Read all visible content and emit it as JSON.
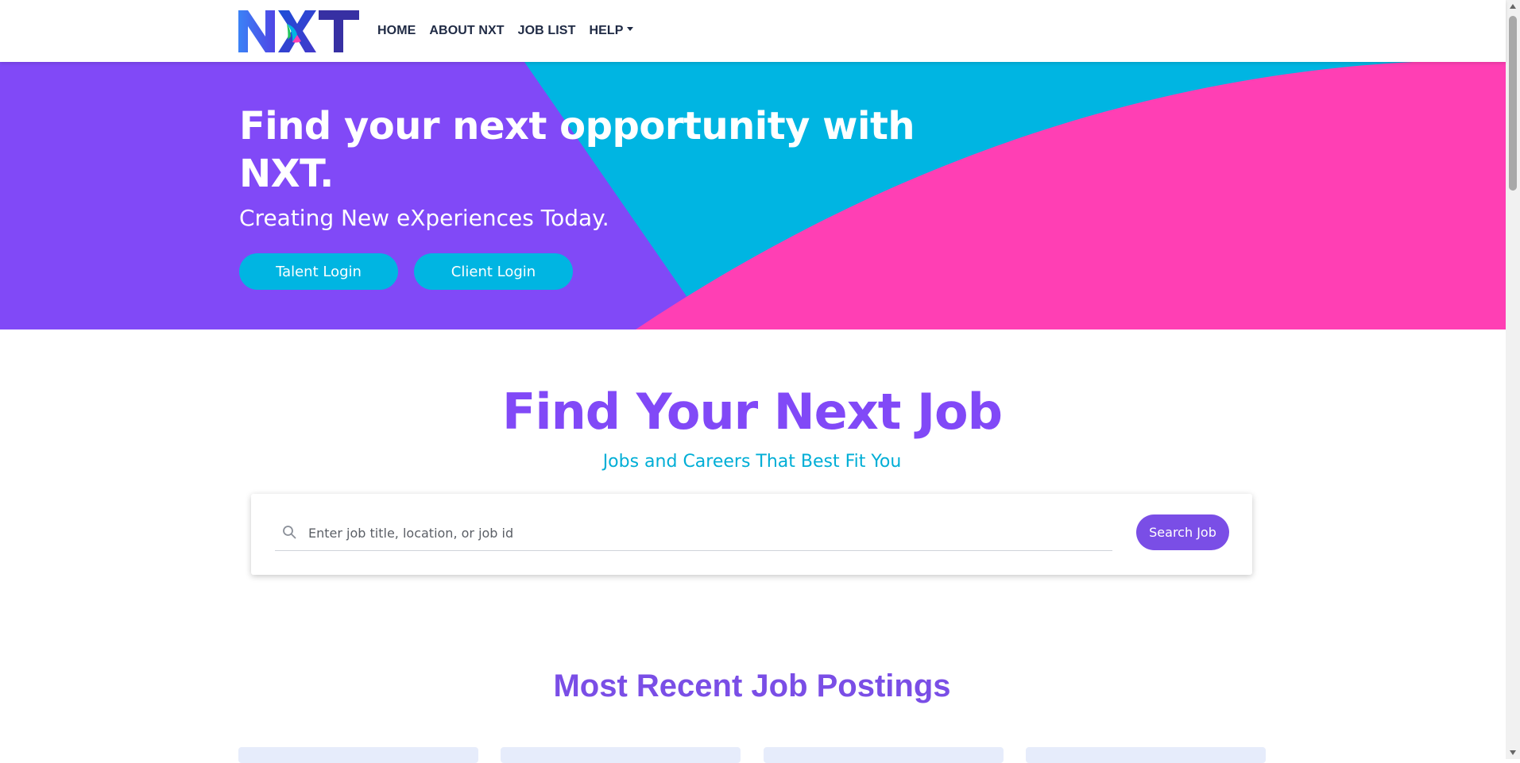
{
  "header": {
    "logo_text": "NXT",
    "nav": {
      "home": "HOME",
      "about": "ABOUT NXT",
      "job_list": "JOB LIST",
      "help": "HELP"
    }
  },
  "hero": {
    "title": "Find your next opportunity with NXT.",
    "subtitle": "Creating New eXperiences Today.",
    "talent_login": "Talent Login",
    "client_login": "Client Login"
  },
  "find": {
    "title": "Find Your Next Job",
    "subtitle": "Jobs and Careers That Best Fit You",
    "search_placeholder": "Enter job title, location, or job id",
    "search_button": "Search Job"
  },
  "recent": {
    "title": "Most Recent Job Postings"
  },
  "colors": {
    "purple": "#8149f7",
    "cyan": "#00b5e2",
    "pink": "#ff3fb4",
    "button_purple": "#7a4ee6",
    "nav_text": "#1f2a44"
  },
  "icons": [
    "search-icon",
    "chevron-down-icon"
  ]
}
